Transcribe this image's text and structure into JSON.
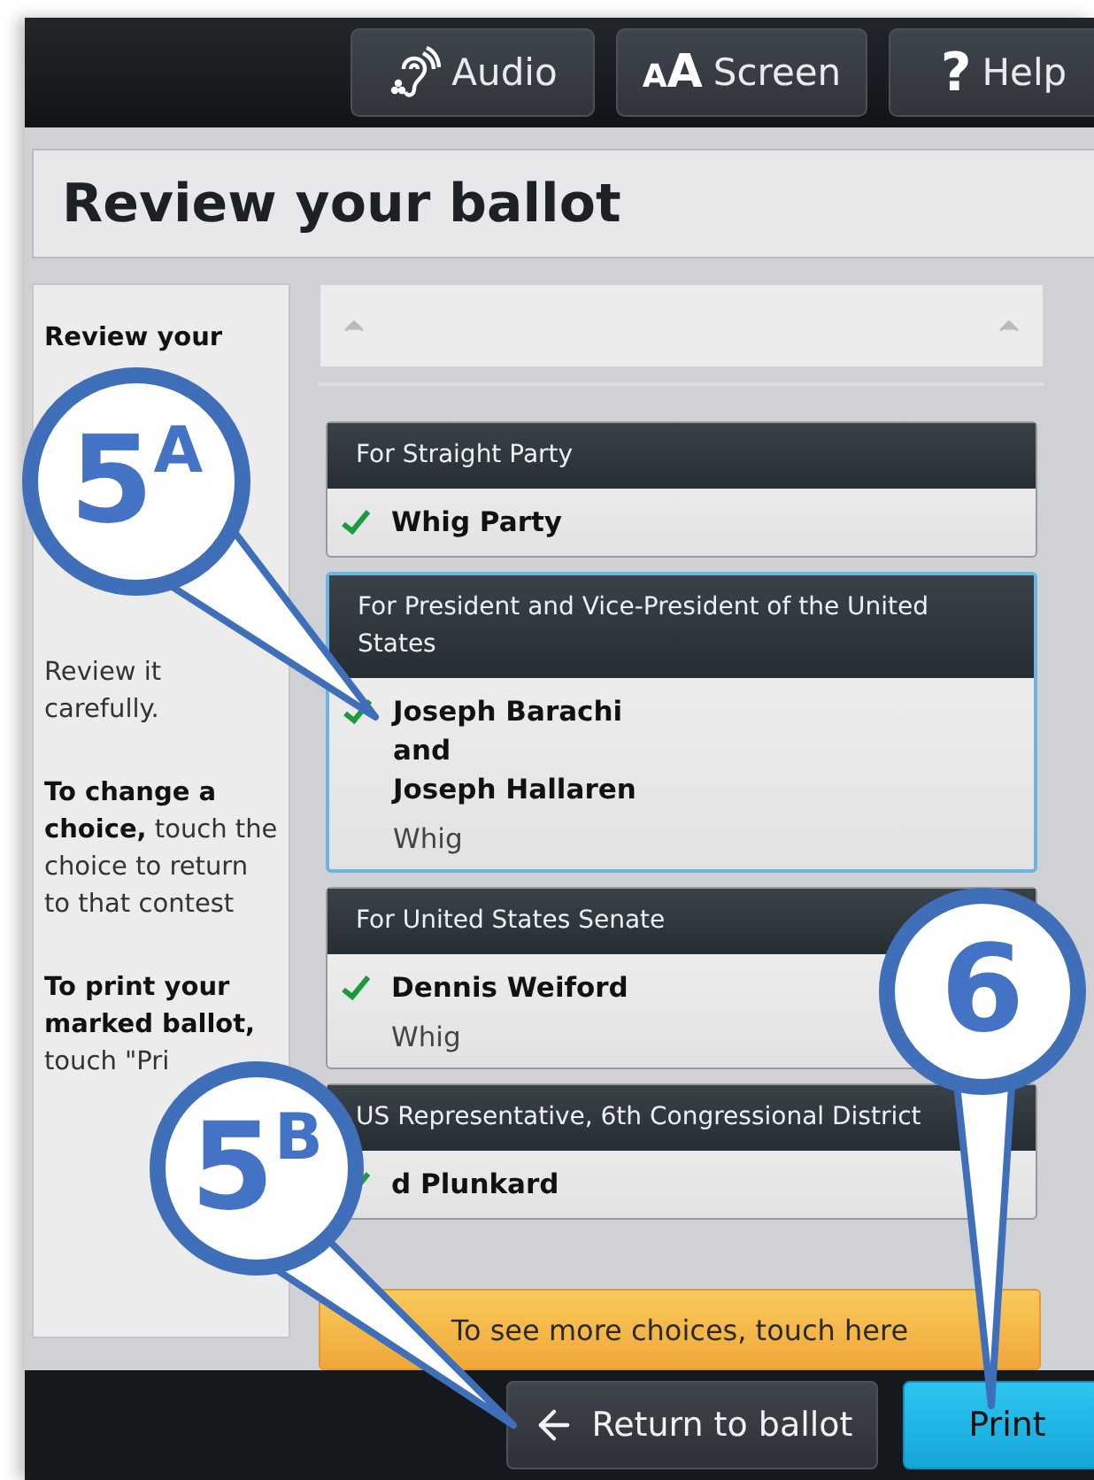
{
  "toolbar": [
    {
      "kind": "audio",
      "label": "Audio"
    },
    {
      "kind": "screen",
      "icon": "AA",
      "label": "Screen"
    },
    {
      "kind": "help",
      "icon": "?",
      "label": "Help"
    }
  ],
  "title": "Review your ballot",
  "sidebar": {
    "paragraphs": [
      "**Review your**",
      "Review it carefully.",
      "**To change a choice,** touch the choice to return to that contest",
      "**To print your marked ballot,** touch \"Pri"
    ]
  },
  "contests": [
    {
      "title": "For Straight Party",
      "selected": false,
      "choices": [
        {
          "name": "Whig Party",
          "selected": true
        }
      ]
    },
    {
      "title": "For President and Vice-President of the United States",
      "selected": true,
      "choices": [
        {
          "name": "Joseph Barachi",
          "selected": true,
          "lines": [
            "and",
            "Joseph Hallaren"
          ],
          "party": "Whig"
        }
      ]
    },
    {
      "title": "For United States Senate",
      "selected": false,
      "choices": [
        {
          "name": "Dennis Weiford",
          "selected": true,
          "party": "Whig"
        }
      ]
    },
    {
      "title": "US Representative, 6th Congressional District",
      "selected": false,
      "choices": [
        {
          "name": "d Plunkard",
          "selected": true
        }
      ]
    }
  ],
  "more_choices": "To see more choices, touch here",
  "footer": {
    "back": "Return to ballot",
    "print": "Print"
  },
  "callouts": [
    {
      "label": "5$^{A}$",
      "kind": "a"
    },
    {
      "label": "5$^{B}$",
      "kind": "b"
    },
    {
      "label": "6",
      "kind": "c"
    }
  ]
}
